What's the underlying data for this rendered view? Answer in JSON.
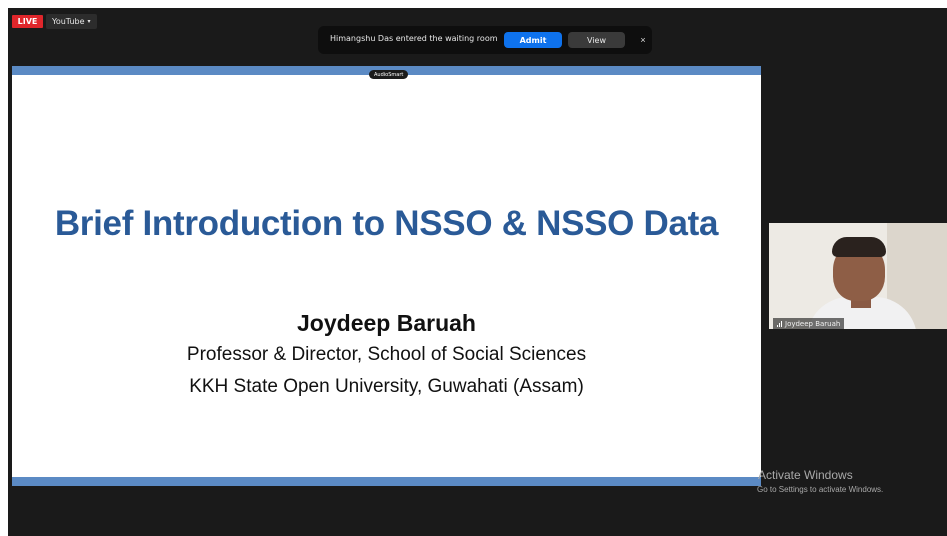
{
  "top_controls": {
    "live_label": "LIVE",
    "stream_label": "YouTube",
    "stream_caret": "▾"
  },
  "notification": {
    "message": "Himangshu Das entered the waiting room",
    "admit_label": "Admit",
    "view_label": "View",
    "close_glyph": "×"
  },
  "share_bar": {
    "label": "AudioSmart"
  },
  "slide": {
    "title": "Brief Introduction to NSSO & NSSO Data",
    "author": "Joydeep Baruah",
    "line1": "Professor & Director, School of Social Sciences",
    "line2": "KKH State Open University, Guwahati (Assam)"
  },
  "participant": {
    "name": "Joydeep Baruah"
  },
  "watermark": {
    "title": "Activate Windows",
    "subtitle": "Go to Settings to activate Windows."
  },
  "colors": {
    "live_red": "#e0262b",
    "admit_blue": "#0e72ed",
    "slide_title_blue": "#2a5a97",
    "slide_band_blue": "#5b8ac4"
  }
}
